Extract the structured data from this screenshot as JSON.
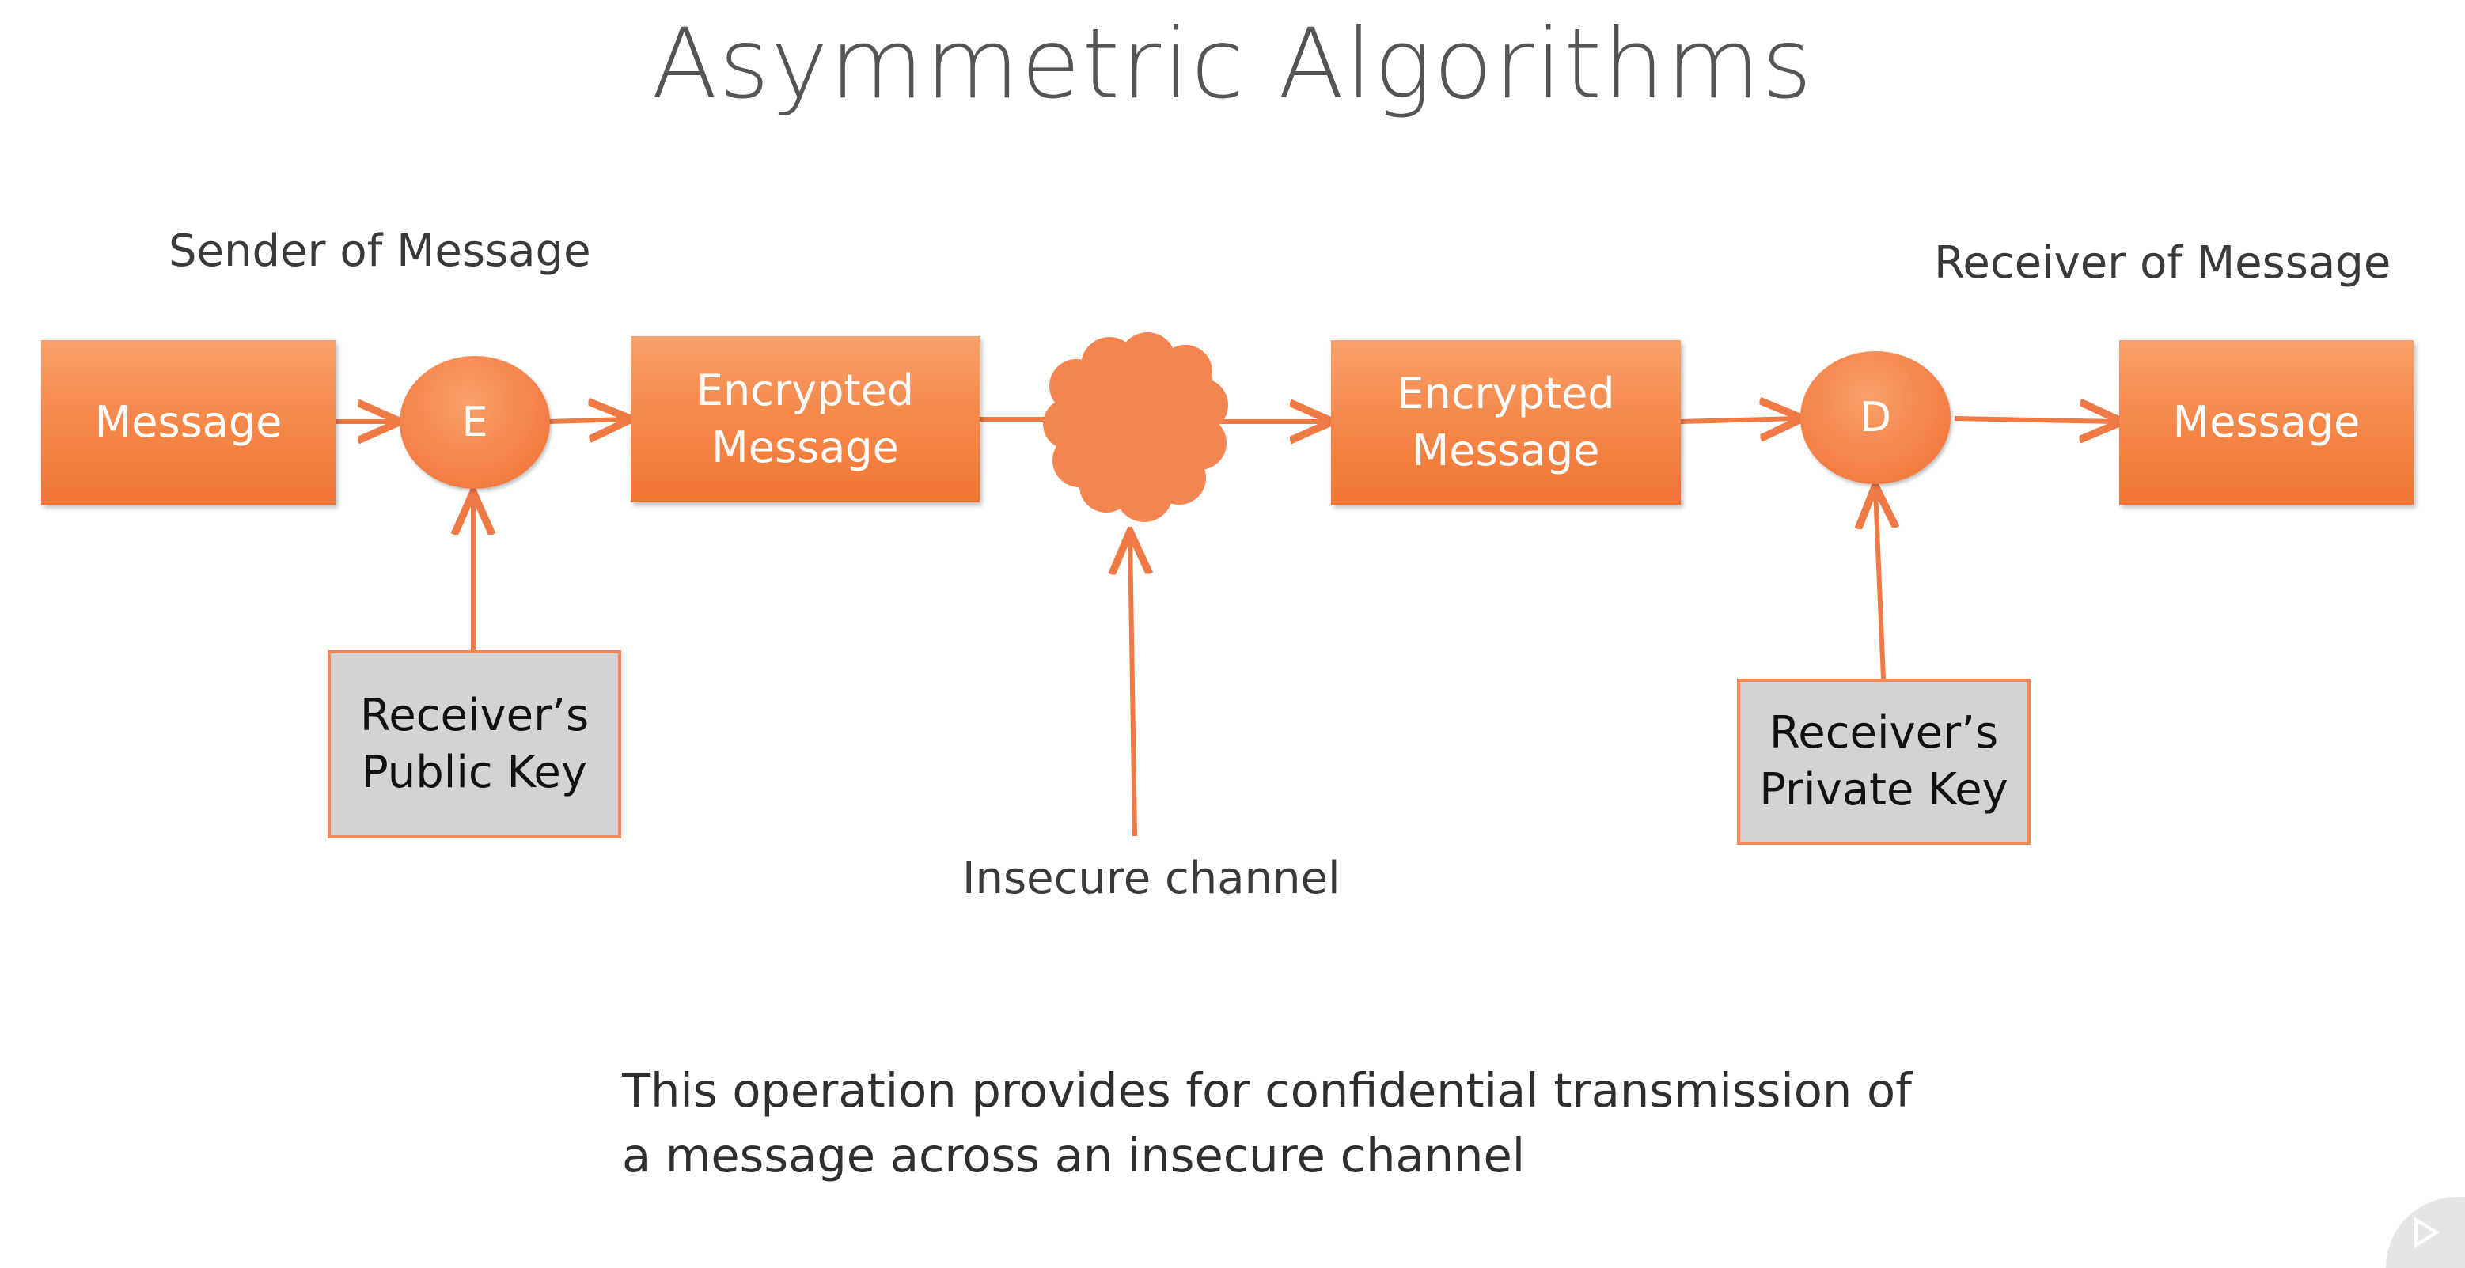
{
  "title": "Asymmetric Algorithms",
  "sender_label": "Sender of Message",
  "receiver_label": "Receiver of Message",
  "nodes": {
    "message_in": "Message",
    "encrypt": "E",
    "encrypted_1": "Encrypted Message",
    "encrypted_2": "Encrypted Message",
    "decrypt": "D",
    "message_out": "Message",
    "public_key": "Receiver’s Public Key",
    "private_key": "Receiver’s Private Key"
  },
  "channel_label": "Insecure channel",
  "caption": "This operation provides for confidential transmission of a message across an insecure channel",
  "colors": {
    "accent": "#f58a4c",
    "key_fill": "#d3d3d3",
    "arrow": "#f07a45"
  },
  "icons": {
    "channel": "cloud-icon",
    "player": "play-icon"
  }
}
